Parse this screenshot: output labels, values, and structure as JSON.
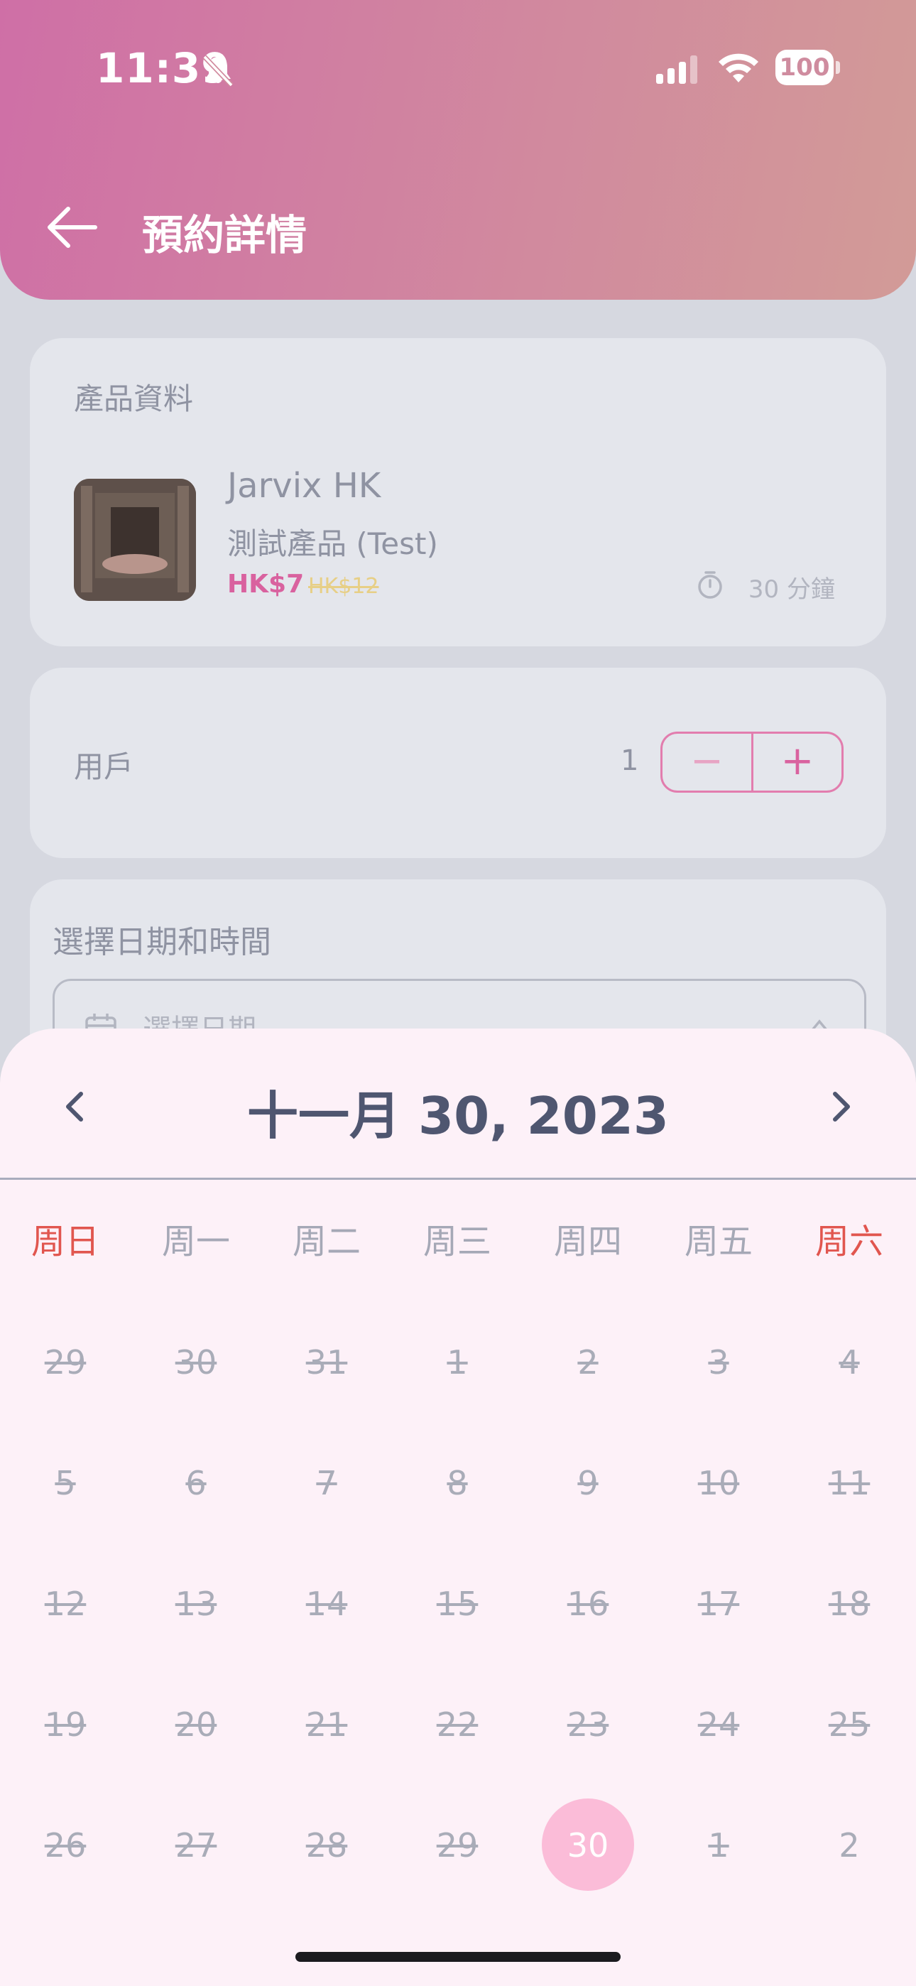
{
  "status_bar": {
    "time": "11:39",
    "battery": "100"
  },
  "header": {
    "title": "預約詳情"
  },
  "product_card": {
    "section_title": "產品資料",
    "shop_name": "Jarvix HK",
    "product_name": "測試產品 (Test)",
    "price": "HK$7",
    "original_price": "HK$12",
    "duration": "30 分鐘"
  },
  "users_card": {
    "label": "用戶",
    "count": "1",
    "minus": "−",
    "plus": "+"
  },
  "date_card": {
    "title": "選擇日期和時間",
    "placeholder": "選擇日期"
  },
  "calendar": {
    "month_title": "十一月 30, 2023",
    "weekdays": [
      "周日",
      "周一",
      "周二",
      "周三",
      "周四",
      "周五",
      "周六"
    ],
    "weeks": [
      [
        "29",
        "30",
        "31",
        "1",
        "2",
        "3",
        "4"
      ],
      [
        "5",
        "6",
        "7",
        "8",
        "9",
        "10",
        "11"
      ],
      [
        "12",
        "13",
        "14",
        "15",
        "16",
        "17",
        "18"
      ],
      [
        "19",
        "20",
        "21",
        "22",
        "23",
        "24",
        "25"
      ],
      [
        "26",
        "27",
        "28",
        "29",
        "30",
        "1",
        "2"
      ]
    ],
    "selected_day": "30"
  },
  "colors": {
    "accent": "#d9629f",
    "weekend": "#e1564f",
    "selected_bg": "#fbbcd8"
  }
}
